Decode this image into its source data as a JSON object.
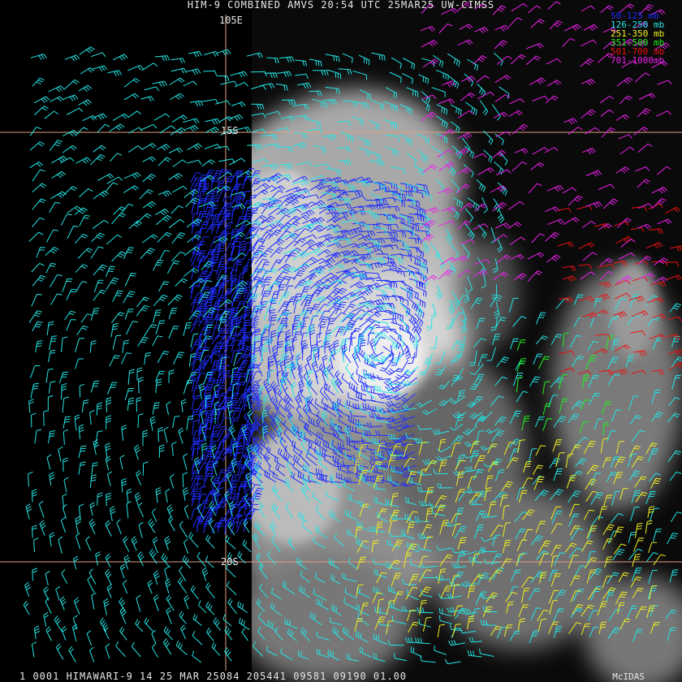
{
  "header": "HIM-9 COMBINED AMVS 20:54 UTC 25MAR25 UW-CIMSS",
  "footer": "1 0001 HIMAWARI-9 14 25 MAR 25084 205441 09581 09190 01.00",
  "brand": "McIDAS",
  "grid_labels": {
    "lon": "105E",
    "lat1": "15S",
    "lat2": "20S"
  },
  "legend": [
    {
      "label": "50-125 mb",
      "color": "#1f2dff"
    },
    {
      "label": "126-250 mb",
      "color": "#22e6e6"
    },
    {
      "label": "251-350 mb",
      "color": "#f0f020"
    },
    {
      "label": "351-500 mb",
      "color": "#20f020"
    },
    {
      "label": "501-700 mb",
      "color": "#f01010"
    },
    {
      "label": "701-1000mb",
      "color": "#f020f0"
    }
  ],
  "colors": {
    "grid": "#e0a080",
    "background": "#000000"
  }
}
